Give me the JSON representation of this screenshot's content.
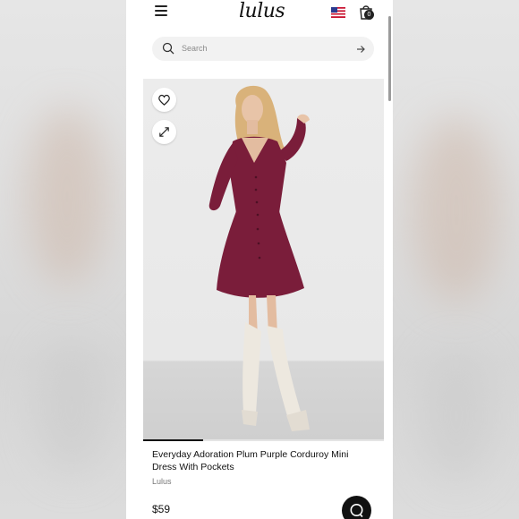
{
  "header": {
    "logo_text": "lulus",
    "cart_count": "0",
    "flag_icon": "us-flag-icon"
  },
  "search": {
    "placeholder": "Search"
  },
  "product": {
    "title": "Everyday Adoration Plum Purple Corduroy Mini Dress With Pockets",
    "brand": "Lulus",
    "price": "$59",
    "gallery_progress": 0.25,
    "image_alt": "Model wearing plum purple corduroy mini dress with white knee-high boots"
  },
  "colors": {
    "dress": "#7a1d3a",
    "boots": "#ede8df",
    "accent": "#111111"
  }
}
